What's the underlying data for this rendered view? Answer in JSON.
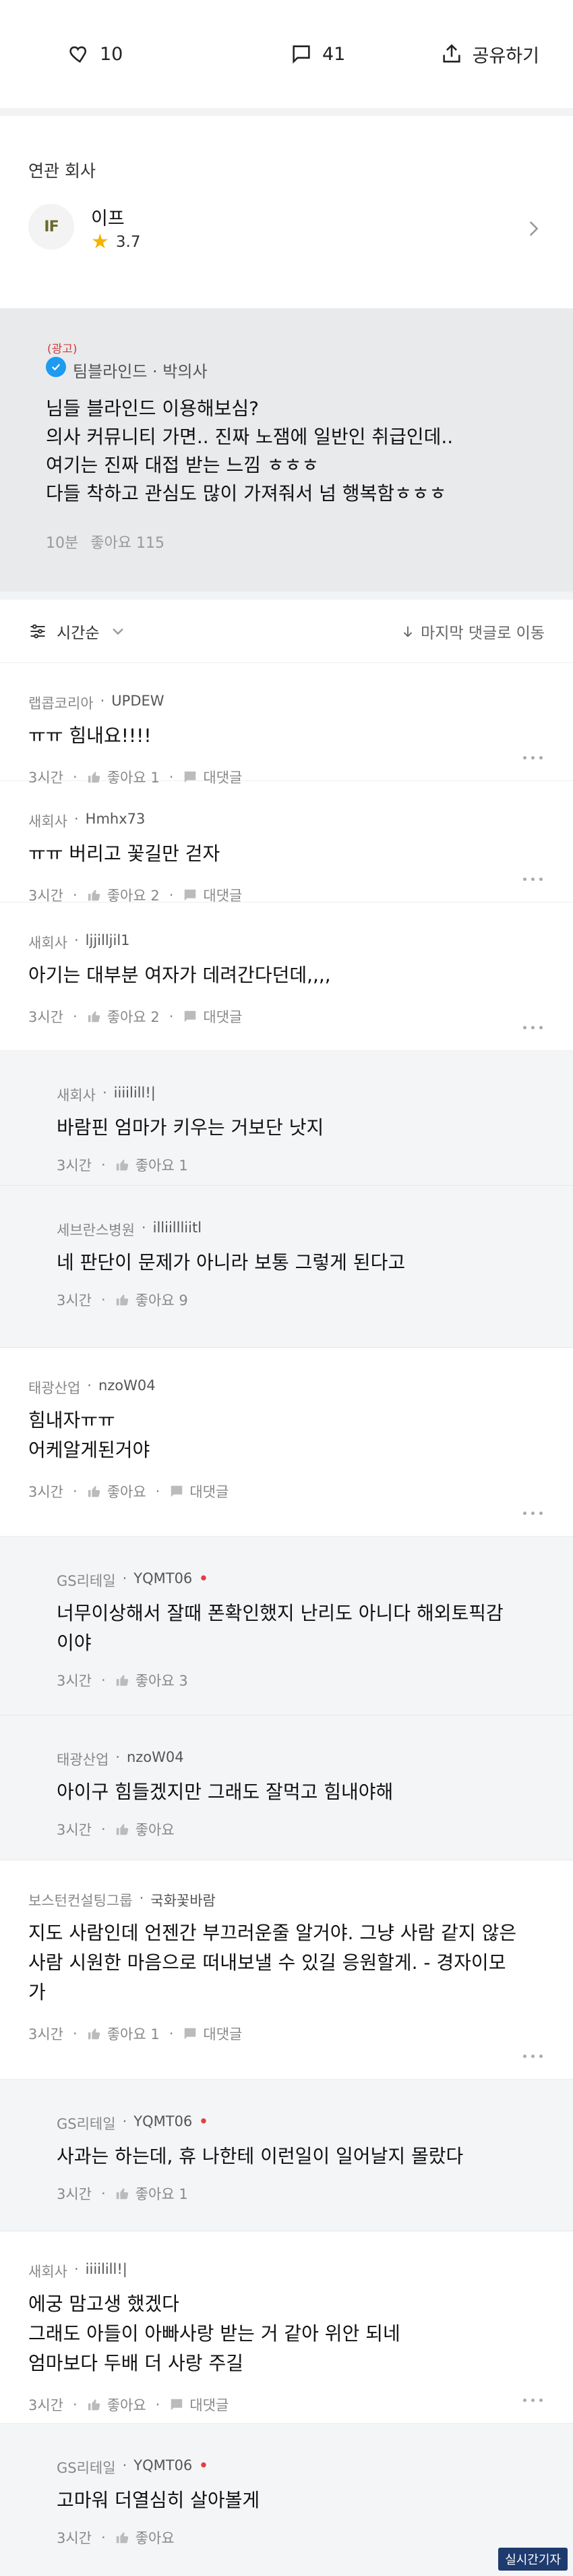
{
  "actions": {
    "likes": "10",
    "comments": "41",
    "share": "공유하기"
  },
  "related": {
    "title": "연관 회사",
    "company_name": "이프",
    "logo_text": "IF",
    "rating": "3.7"
  },
  "ad": {
    "badge": "(광고)",
    "author": "팀블라인드 · 박의사",
    "lines": [
      "님들 블라인드 이용해보심?",
      "의사 커뮤니티 가면.. 진짜 노잼에 일반인 취급인데..",
      "여기는 진짜 대접 받는 느낌 ㅎㅎㅎ",
      "다들 착하고 관심도 많이 가져줘서 넘 행복함ㅎㅎㅎ"
    ],
    "time": "10분",
    "likes": "좋아요 115"
  },
  "sort": {
    "label": "시간순",
    "jump": "마지막 댓글로 이동"
  },
  "comments": [
    {
      "company": "랩콥코리아",
      "author": "UPDEW",
      "lines": [
        "ㅠㅠ 힘내요!!!!"
      ],
      "time": "3시간",
      "likes": "좋아요 1",
      "reply": "대댓글"
    },
    {
      "company": "새회사",
      "author": "Hmhx73",
      "lines": [
        "ㅠㅠ 버리고 꽃길만 걷자"
      ],
      "time": "3시간",
      "likes": "좋아요 2",
      "reply": "대댓글"
    },
    {
      "company": "새회사",
      "author": "ljjilljil1",
      "lines": [
        "아기는 대부분 여자가 데려간다던데,,,,"
      ],
      "time": "3시간",
      "likes": "좋아요 2",
      "reply": "대댓글"
    },
    {
      "company": "새회사",
      "author": "iiiilill!|",
      "lines": [
        "바람핀 엄마가 키우는 거보단 낫지"
      ],
      "time": "3시간",
      "likes": "좋아요 1",
      "reply": ""
    },
    {
      "company": "세브란스병원",
      "author": "illiillliitl",
      "lines": [
        "네 판단이 문제가 아니라 보통 그렇게 된다고"
      ],
      "time": "3시간",
      "likes": "좋아요 9",
      "reply": ""
    },
    {
      "company": "태광산업",
      "author": "nzoW04",
      "lines": [
        "힘내자ㅠㅠ",
        "어케알게된거야"
      ],
      "time": "3시간",
      "likes": "좋아요",
      "reply": "대댓글"
    },
    {
      "company": "GS리테일",
      "author": "YQMT06",
      "lines": [
        "너무이상해서 잘때 폰확인했지 난리도 아니다 해외토픽감",
        "이야"
      ],
      "time": "3시간",
      "likes": "좋아요 3",
      "reply": ""
    },
    {
      "company": "태광산업",
      "author": "nzoW04",
      "lines": [
        "아이구 힘들겠지만 그래도 잘먹고 힘내야해"
      ],
      "time": "3시간",
      "likes": "좋아요",
      "reply": ""
    },
    {
      "company": "보스턴컨설팅그룹",
      "author": "국화꽃바람",
      "lines": [
        "지도 사람인데 언젠간 부끄러운줄 알거야. 그냥 사람 같지 않은",
        "사람 시원한 마음으로 떠내보낼 수 있길 응원할게. - 경자이모",
        "가"
      ],
      "time": "3시간",
      "likes": "좋아요 1",
      "reply": "대댓글"
    },
    {
      "company": "GS리테일",
      "author": "YQMT06",
      "lines": [
        "사과는 하는데, 휴 나한테 이런일이 일어날지 몰랐다"
      ],
      "time": "3시간",
      "likes": "좋아요 1",
      "reply": ""
    },
    {
      "company": "새회사",
      "author": "iiiilill!|",
      "lines": [
        "에궁 맘고생 했겠다",
        "그래도 아들이 아빠사랑 받는 거 같아 위안 되네",
        "엄마보다 두배 더 사랑 주길"
      ],
      "time": "3시간",
      "likes": "좋아요",
      "reply": "대댓글"
    },
    {
      "company": "GS리테일",
      "author": "YQMT06",
      "lines": [
        "고마워 더열심히 살아볼게"
      ],
      "time": "3시간",
      "likes": "좋아요",
      "reply": ""
    }
  ],
  "watermark": "실시간기자",
  "colors": {
    "accent_blue": "#1d9bf0",
    "star": "#f4b400",
    "ad_red": "#d23b3b",
    "reply_bg": "#f4f5f7",
    "gap_bg": "#f2f3f5"
  }
}
